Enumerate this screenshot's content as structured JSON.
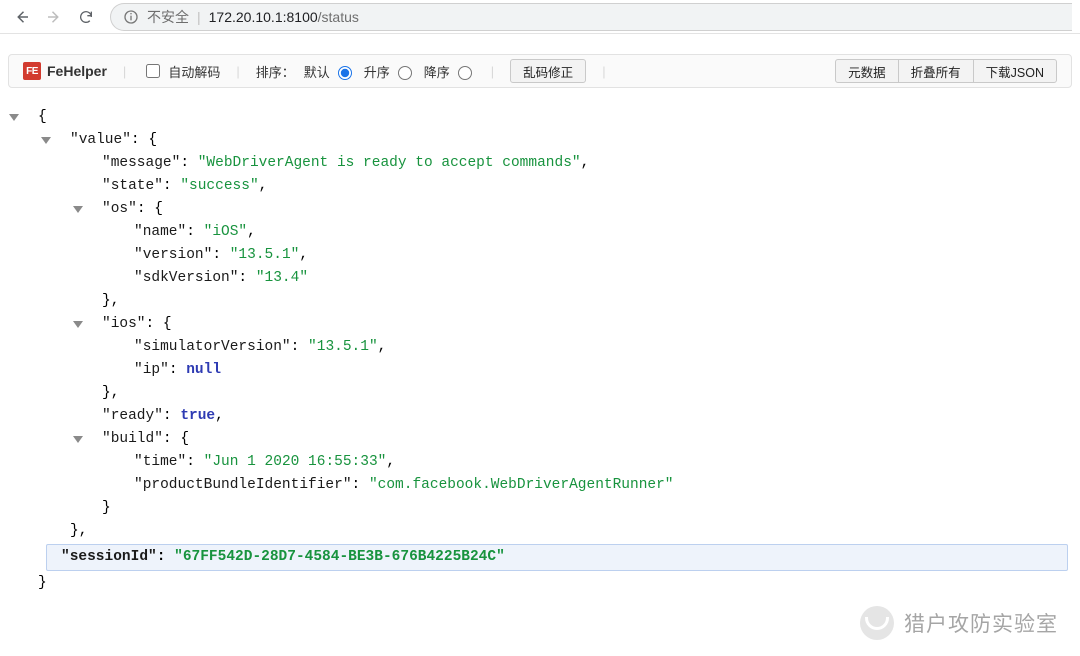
{
  "chrome": {
    "insecure_label": "不安全",
    "url_host": "172.20.10.1",
    "url_port": ":8100",
    "url_path": "/status"
  },
  "fehelper": {
    "brand_badge": "FE",
    "brand_name": "FeHelper",
    "auto_decode": "自动解码",
    "sort_label": "排序：",
    "sort_default": "默认",
    "sort_asc": "升序",
    "sort_desc": "降序",
    "btn_fix": "乱码修正",
    "btn_meta": "元数据",
    "btn_collapse": "折叠所有",
    "btn_download": "下载JSON"
  },
  "json": {
    "open": "{",
    "close": "}",
    "comma": ",",
    "colon": ": ",
    "value_key": "\"value\"",
    "message_key": "\"message\"",
    "message_val": "\"WebDriverAgent is ready to accept commands\"",
    "state_key": "\"state\"",
    "state_val": "\"success\"",
    "os_key": "\"os\"",
    "name_key": "\"name\"",
    "name_val": "\"iOS\"",
    "version_key": "\"version\"",
    "version_val": "\"13.5.1\"",
    "sdkVersion_key": "\"sdkVersion\"",
    "sdkVersion_val": "\"13.4\"",
    "ios_key": "\"ios\"",
    "simver_key": "\"simulatorVersion\"",
    "simver_val": "\"13.5.1\"",
    "ip_key": "\"ip\"",
    "ip_val": "null",
    "ready_key": "\"ready\"",
    "ready_val": "true",
    "build_key": "\"build\"",
    "time_key": "\"time\"",
    "time_val": "\"Jun 1 2020 16:55:33\"",
    "pbi_key": "\"productBundleIdentifier\"",
    "pbi_val": "\"com.facebook.WebDriverAgentRunner\"",
    "sessionId_key": "\"sessionId\"",
    "sessionId_val": "\"67FF542D-28D7-4584-BE3B-676B4225B24C\""
  },
  "watermark": {
    "text": "猎户攻防实验室"
  }
}
